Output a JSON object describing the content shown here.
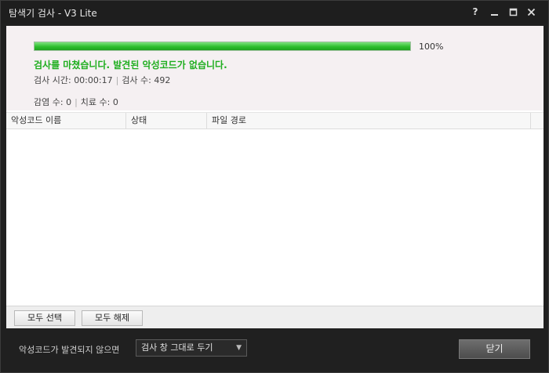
{
  "window": {
    "title": "탐색기 검사 - V3 Lite",
    "controls": {
      "help": "?",
      "minimize_icon": "minimize-icon",
      "maximize_icon": "maximize-icon",
      "close_icon": "close-icon"
    }
  },
  "scan": {
    "progress": 100,
    "progress_text": "100%",
    "message": "검사를 마쳤습니다. 발견된 악성코드가 없습니다.",
    "time_label": "검사 시간:",
    "time_value": "00:00:17",
    "count_label": "검사 수:",
    "count_value": "492",
    "infected_label": "감염 수:",
    "infected_value": "0",
    "cured_label": "치료 수:",
    "cured_value": "0"
  },
  "table": {
    "columns": [
      "악성코드 이름",
      "상태",
      "파일 경로"
    ],
    "rows": []
  },
  "buttons": {
    "select_all": "모두 선택",
    "deselect_all": "모두 해제"
  },
  "footer": {
    "label": "악성코드가 발견되지 않으면",
    "dropdown_value": "검사 창 그대로 두기",
    "close_label": "닫기"
  },
  "colors": {
    "progress": "#2fbf2f",
    "message": "#1fae1f",
    "window_bg": "#1e1e1e"
  }
}
